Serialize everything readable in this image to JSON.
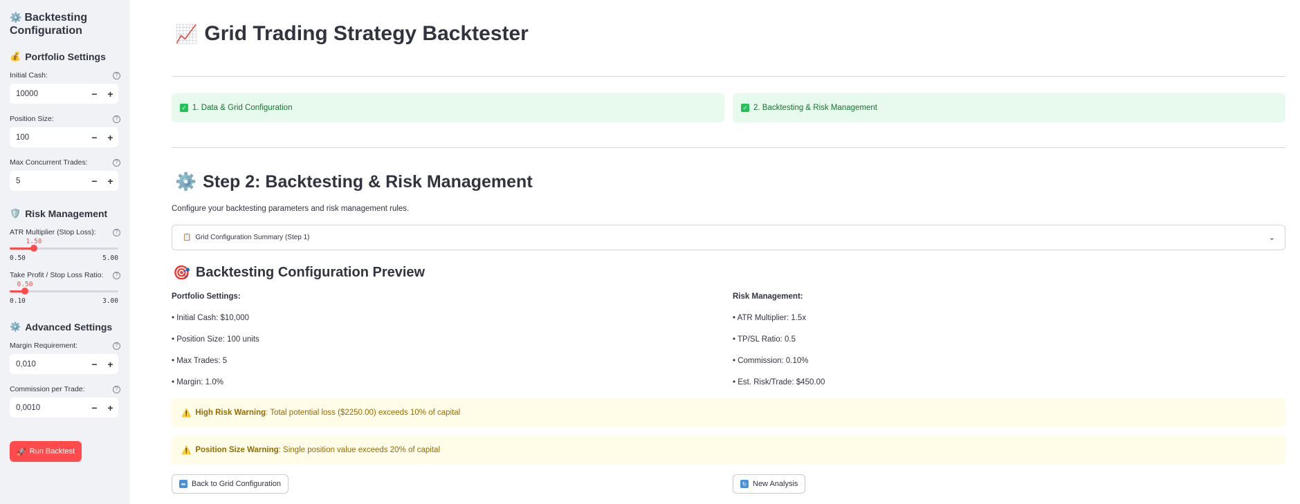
{
  "sidebar": {
    "title": "Backtesting Configuration",
    "portfolio": {
      "heading": "Portfolio Settings",
      "initial_cash_label": "Initial Cash:",
      "initial_cash_value": "10000",
      "position_size_label": "Position Size:",
      "position_size_value": "100",
      "max_trades_label": "Max Concurrent Trades:",
      "max_trades_value": "5"
    },
    "risk": {
      "heading": "Risk Management",
      "atr_label": "ATR Multiplier (Stop Loss):",
      "atr_value": "1.50",
      "atr_min": "0.50",
      "atr_max": "5.00",
      "atr_fraction": 0.222,
      "tp_label": "Take Profit / Stop Loss Ratio:",
      "tp_value": "0.50",
      "tp_min": "0.10",
      "tp_max": "3.00",
      "tp_fraction": 0.138
    },
    "advanced": {
      "heading": "Advanced Settings",
      "margin_label": "Margin Requirement:",
      "margin_value": "0,010",
      "commission_label": "Commission per Trade:",
      "commission_value": "0,0010"
    },
    "run_button": "Run Backtest",
    "step_minus": "−",
    "step_plus": "+",
    "help_glyph": "?"
  },
  "main": {
    "title": "Grid Trading Strategy Backtester",
    "steps": [
      "1. Data & Grid Configuration",
      "2. Backtesting & Risk Management"
    ],
    "step_heading": "Step 2: Backtesting & Risk Management",
    "caption": "Configure your backtesting parameters and risk management rules.",
    "expander_label": "Grid Configuration Summary (Step 1)",
    "preview_heading": "Backtesting Configuration Preview",
    "portfolio_col": {
      "heading": "Portfolio Settings:",
      "items": [
        "• Initial Cash: $10,000",
        "• Position Size: 100 units",
        "• Max Trades: 5",
        "• Margin: 1.0%"
      ]
    },
    "risk_col": {
      "heading": "Risk Management:",
      "items": [
        "• ATR Multiplier: 1.5x",
        "• TP/SL Ratio: 0.5",
        "• Commission: 0.10%",
        "• Est. Risk/Trade: $450.00"
      ]
    },
    "warnings": [
      {
        "title": "High Risk Warning",
        "text": ": Total potential loss ($2250.00) exceeds 10% of capital"
      },
      {
        "title": "Position Size Warning",
        "text": ": Single position value exceeds 20% of capital"
      }
    ],
    "back_button": "Back to Grid Configuration",
    "new_button": "New Analysis"
  },
  "colors": {
    "accent": "#ff4b4b",
    "success_bg": "#e8f9ee",
    "success_text": "#177233",
    "warning_bg": "#fffce7",
    "warning_text": "#926c05",
    "sidebar_bg": "#f0f2f6"
  },
  "icons": {
    "title": "gear-icon",
    "portfolio": "money-bag-icon",
    "risk": "shield-icon",
    "advanced": "gear-icon",
    "run": "rocket-icon",
    "app": "chart-increasing-icon",
    "step": "gear-icon",
    "expander": "clipboard-icon",
    "preview": "target-icon",
    "warning": "warning-icon",
    "back": "back-arrow-icon",
    "new": "refresh-icon"
  }
}
